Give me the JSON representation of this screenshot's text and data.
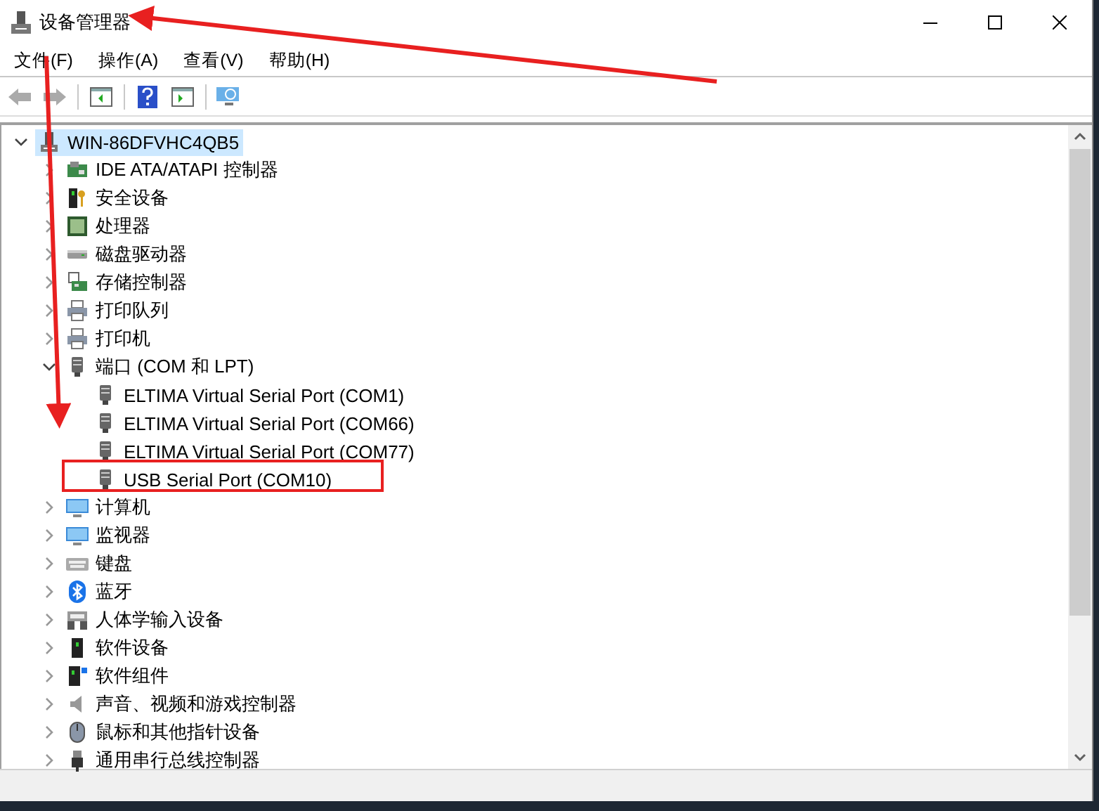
{
  "window": {
    "title": "设备管理器"
  },
  "menu": [
    "文件(F)",
    "操作(A)",
    "查看(V)",
    "帮助(H)"
  ],
  "tree": {
    "label": "WIN-86DFVHC4QB5",
    "kind": "host",
    "selected": true,
    "expanded": true,
    "highlighted": false,
    "children": [
      {
        "label": "IDE ATA/ATAPI 控制器",
        "kind": "ide",
        "selected": false,
        "expanded": false,
        "highlighted": false
      },
      {
        "label": "安全设备",
        "kind": "security",
        "selected": false,
        "expanded": false,
        "highlighted": false
      },
      {
        "label": "处理器",
        "kind": "cpu",
        "selected": false,
        "expanded": false,
        "highlighted": false
      },
      {
        "label": "磁盘驱动器",
        "kind": "disk",
        "selected": false,
        "expanded": false,
        "highlighted": false
      },
      {
        "label": "存储控制器",
        "kind": "storage",
        "selected": false,
        "expanded": false,
        "highlighted": false
      },
      {
        "label": "打印队列",
        "kind": "printer",
        "selected": false,
        "expanded": false,
        "highlighted": false
      },
      {
        "label": "打印机",
        "kind": "printer",
        "selected": false,
        "expanded": false,
        "highlighted": false
      },
      {
        "label": "端口 (COM 和 LPT)",
        "kind": "port",
        "selected": false,
        "expanded": true,
        "highlighted": false,
        "children": [
          {
            "label": "ELTIMA Virtual Serial Port (COM1)",
            "kind": "port",
            "selected": false,
            "highlighted": false
          },
          {
            "label": "ELTIMA Virtual Serial Port (COM66)",
            "kind": "port",
            "selected": false,
            "highlighted": false
          },
          {
            "label": "ELTIMA Virtual Serial Port (COM77)",
            "kind": "port",
            "selected": false,
            "highlighted": false
          },
          {
            "label": "USB Serial Port (COM10)",
            "kind": "port",
            "selected": false,
            "highlighted": true
          }
        ]
      },
      {
        "label": "计算机",
        "kind": "monitor",
        "selected": false,
        "expanded": false,
        "highlighted": false
      },
      {
        "label": "监视器",
        "kind": "monitor",
        "selected": false,
        "expanded": false,
        "highlighted": false
      },
      {
        "label": "键盘",
        "kind": "keyboard",
        "selected": false,
        "expanded": false,
        "highlighted": false
      },
      {
        "label": "蓝牙",
        "kind": "bluetooth",
        "selected": false,
        "expanded": false,
        "highlighted": false
      },
      {
        "label": "人体学输入设备",
        "kind": "hid",
        "selected": false,
        "expanded": false,
        "highlighted": false
      },
      {
        "label": "软件设备",
        "kind": "software",
        "selected": false,
        "expanded": false,
        "highlighted": false
      },
      {
        "label": "软件组件",
        "kind": "component",
        "selected": false,
        "expanded": false,
        "highlighted": false
      },
      {
        "label": "声音、视频和游戏控制器",
        "kind": "audio",
        "selected": false,
        "expanded": false,
        "highlighted": false
      },
      {
        "label": "鼠标和其他指针设备",
        "kind": "mouse",
        "selected": false,
        "expanded": false,
        "highlighted": false
      },
      {
        "label": "通用串行总线控制器",
        "kind": "usb",
        "selected": false,
        "expanded": false,
        "highlighted": false
      }
    ]
  }
}
